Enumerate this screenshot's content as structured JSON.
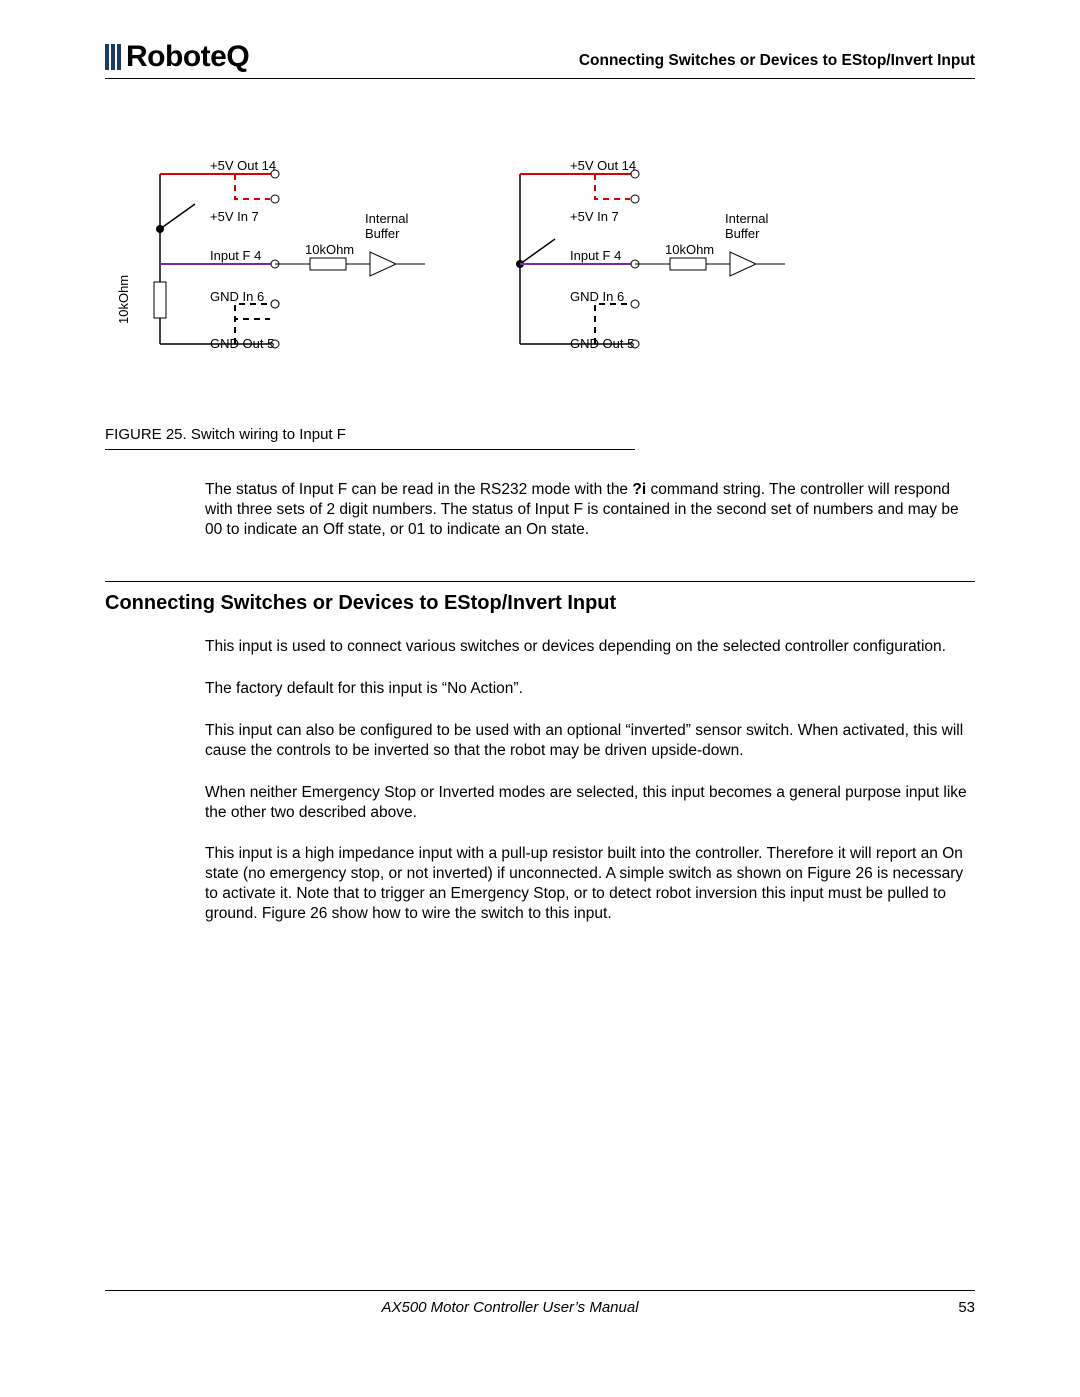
{
  "logo_text": "RoboteQ",
  "header_title": "Connecting Switches or Devices to EStop/Invert Input",
  "diagram": {
    "labels": {
      "v5out": "+5V Out  14",
      "v5in": "+5V In  7",
      "inputf": "Input F  4",
      "gndin": "GND In  6",
      "gndout": "GND Out  5",
      "r_inline": "10kOhm",
      "r_pulldown": "10kOhm",
      "buffer": "Internal\nBuffer"
    }
  },
  "figure_caption": "FIGURE 25.  Switch wiring to Input F",
  "para1_a": "The status of Input F can be read in the RS232 mode with the ",
  "para1_cmd": "?i",
  "para1_b": " command string. The controller will respond with three sets of 2 digit numbers. The status of Input F is contained in the second set of numbers and may be 00 to indicate an Off state, or 01 to indicate an On state.",
  "section_heading": "Connecting Switches or Devices to EStop/Invert Input",
  "sec_p1": "This input is used to connect various switches or devices depending on the selected controller configuration.",
  "sec_p2": "The factory default for this input is “No Action”.",
  "sec_p3": "This input can also be configured to be used with an optional “inverted” sensor switch. When activated, this will cause the controls to be inverted so that the robot may be driven upside-down.",
  "sec_p4": "When neither Emergency Stop or Inverted modes are selected, this input becomes a general purpose input like the other two described above.",
  "sec_p5": "This input is a high impedance input with a pull-up resistor built into the controller. Therefore it will report an On state (no emergency stop, or not inverted) if unconnected. A simple switch as shown on Figure 26 is necessary to activate it. Note that to trigger an Emergency Stop, or to detect robot inversion this input must be pulled to ground. Figure 26 show how to wire the switch to this input.",
  "footer_title": "AX500 Motor Controller User’s Manual",
  "page_number": "53"
}
